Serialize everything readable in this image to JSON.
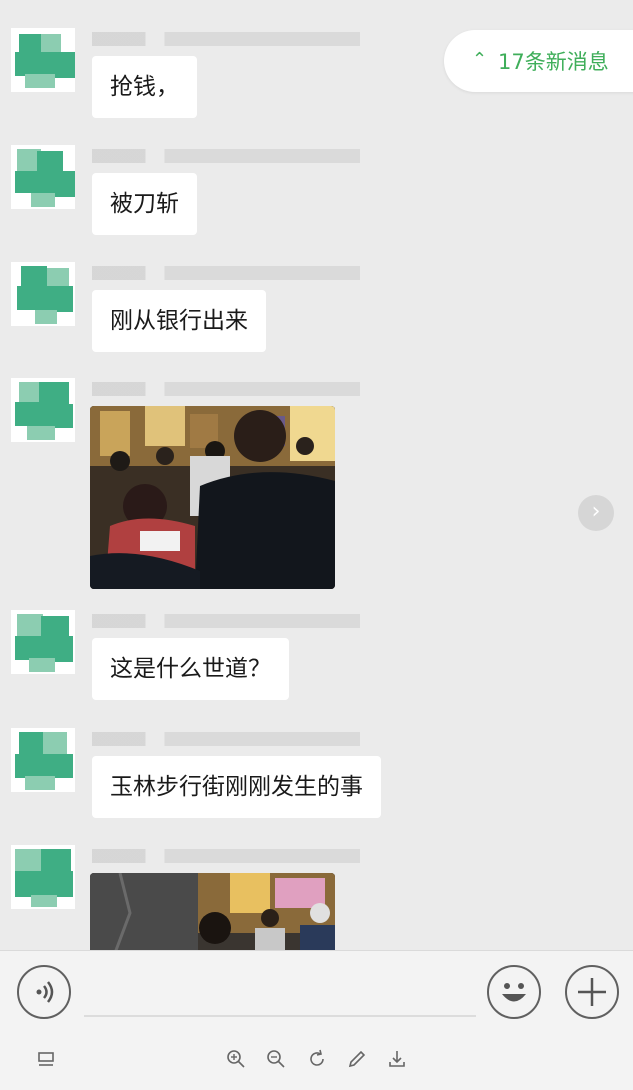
{
  "new_messages": {
    "label": "17条新消息",
    "icon": "double-chevron-up-icon"
  },
  "messages": [
    {
      "type": "text",
      "text": "抢钱，"
    },
    {
      "type": "text",
      "text": "被刀斩"
    },
    {
      "type": "text",
      "text": "刚从银行出来"
    },
    {
      "type": "image",
      "description": ""
    },
    {
      "type": "text",
      "text": "这是什么世道？"
    },
    {
      "type": "text",
      "text": "玉林步行街刚刚发生的事"
    },
    {
      "type": "image",
      "description": ""
    }
  ],
  "input_bar": {
    "voice_icon": "voice-icon",
    "emoji_icon": "emoji-icon",
    "plus_icon": "plus-icon"
  },
  "toolbar": {
    "icons": [
      "layout-icon",
      "zoom-in-icon",
      "zoom-out-icon",
      "rotate-icon",
      "edit-icon",
      "download-icon"
    ]
  },
  "colors": {
    "accent": "#3fae5a",
    "background": "#ebebeb",
    "bubble": "#ffffff"
  }
}
